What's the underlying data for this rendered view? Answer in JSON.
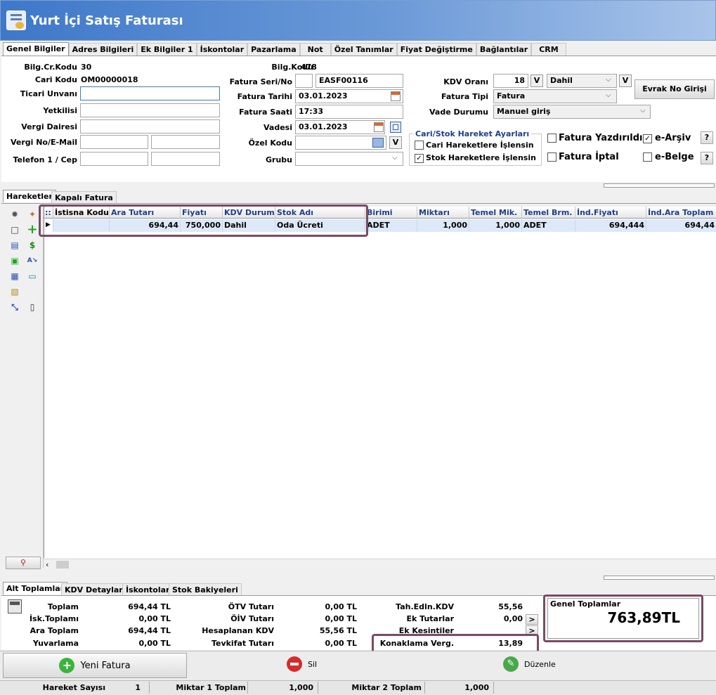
{
  "window": {
    "title": "Yurt İçi Satış Faturası"
  },
  "tabs": [
    "Genel Bilgiler",
    "Adres Bilgileri",
    "Ek Bilgiler 1",
    "İskontolar",
    "Pazarlama",
    "Not",
    "Özel Tanımlar",
    "Fiyat Değiştirme",
    "Bağlantılar",
    "CRM"
  ],
  "left": {
    "bilg_cr_kodu_label": "Bilg.Cr.Kodu",
    "bilg_cr_kodu": "30",
    "cari_kodu_label": "Cari Kodu",
    "cari_kodu": "OM00000018",
    "ticari_unvani_label": "Ticari Unvanı",
    "yetkilisi_label": "Yetkilisi",
    "vergi_dairesi_label": "Vergi Dairesi",
    "vergi_no_label": "Vergi No/E-Mail",
    "telefon_label": "Telefon 1 / Cep"
  },
  "middle": {
    "bilg_kodu_label": "Bilg.Kodu",
    "bilg_kodu": "478",
    "fatura_seri_label": "Fatura Seri/No",
    "fatura_no": "EASF00116",
    "fatura_tarihi_label": "Fatura Tarihi",
    "fatura_tarihi": "03.01.2023",
    "fatura_saati_label": "Fatura Saati",
    "fatura_saati": "17:33",
    "vadesi_label": "Vadesi",
    "vadesi": "03.01.2023",
    "ozel_kodu_label": "Özel Kodu",
    "grubu_label": "Grubu",
    "v": "V"
  },
  "right": {
    "kdv_orani_label": "KDV Oranı",
    "kdv_orani": "18",
    "kdv_tip": "Dahil",
    "fatura_tipi_label": "Fatura Tipi",
    "fatura_tipi": "Fatura",
    "vade_durumu_label": "Vade Durumu",
    "vade_durumu": "Manuel giriş",
    "evrak_no_button": "Evrak No Girişi",
    "group_title": "Cari/Stok Hareket Ayarları",
    "cari_check": "Cari Hareketlere İşlensin",
    "stok_check": "Stok Hareketlere İşlensin",
    "fatura_yazdirildi": "Fatura Yazdırıldı",
    "fatura_iptal": "Fatura İptal",
    "e_arsiv": "e-Arşiv",
    "e_belge": "e-Belge",
    "q": "?",
    "check_mark": "✓"
  },
  "hareket_tabs": [
    "Hareketler",
    "Kapalı Fatura"
  ],
  "grid": {
    "headers": [
      "İstisna Kodu",
      "Ara Tutarı",
      "Fiyatı",
      "KDV Durumu",
      "Stok Adı",
      "Birimi",
      "Miktarı",
      "Temel Mik.",
      "Temel Brm.",
      "İnd.Fiyatı",
      "İnd.Ara Toplam"
    ],
    "row": [
      "",
      "694,44",
      "750,000",
      "Dahil",
      "Oda Ücreti",
      "ADET",
      "1,000",
      "1,000",
      "ADET",
      "694,444",
      "694,44"
    ]
  },
  "bottom_tabs": [
    "Alt Toplamlar",
    "KDV Detayları",
    "İskontolar",
    "Stok Bakiyeleri"
  ],
  "totals": {
    "toplam_label": "Toplam",
    "toplam": "694,44 TL",
    "isk_toplami_label": "İsk.Toplamı",
    "isk_toplami": "0,00 TL",
    "ara_toplam_label": "Ara Toplam",
    "ara_toplam": "694,44 TL",
    "yuvarlama_label": "Yuvarlama",
    "yuvarlama": "0,00 TL",
    "otv_label": "ÖTV Tutarı",
    "otv": "0,00 TL",
    "oiv_label": "ÖİV Tutarı",
    "oiv": "0,00 TL",
    "hes_kdv_label": "Hesaplanan KDV",
    "hes_kdv": "55,56 TL",
    "tevkifat_label": "Tevkifat Tutarı",
    "tevkifat": "0,00 TL",
    "tah_kdv_label": "Tah.Edln.KDV",
    "tah_kdv": "55,56",
    "ek_tutarlar_label": "Ek Tutarlar",
    "ek_tutarlar": "0,00",
    "ek_kesintiler_label": "Ek Kesintiler",
    "konaklama_label": "Konaklama Verg.",
    "konaklama": "13,89",
    "genel_label": "Genel Toplamlar",
    "genel": "763,89TL",
    "arrow": ">"
  },
  "actions": {
    "yeni": "Yeni Fatura",
    "sil": "Sil",
    "duzenle": "Düzenle"
  },
  "status": {
    "hareket_sayisi_label": "Hareket Sayısı",
    "hareket_sayisi": "1",
    "miktar1_label": "Miktar 1 Toplam",
    "miktar1": "1,000",
    "miktar2_label": "Miktar 2 Toplam",
    "miktar2": "1,000"
  },
  "colors": {
    "accent": "#3e78c9",
    "highlight": "#7b4a64",
    "selected_row": "#dde9f8"
  }
}
